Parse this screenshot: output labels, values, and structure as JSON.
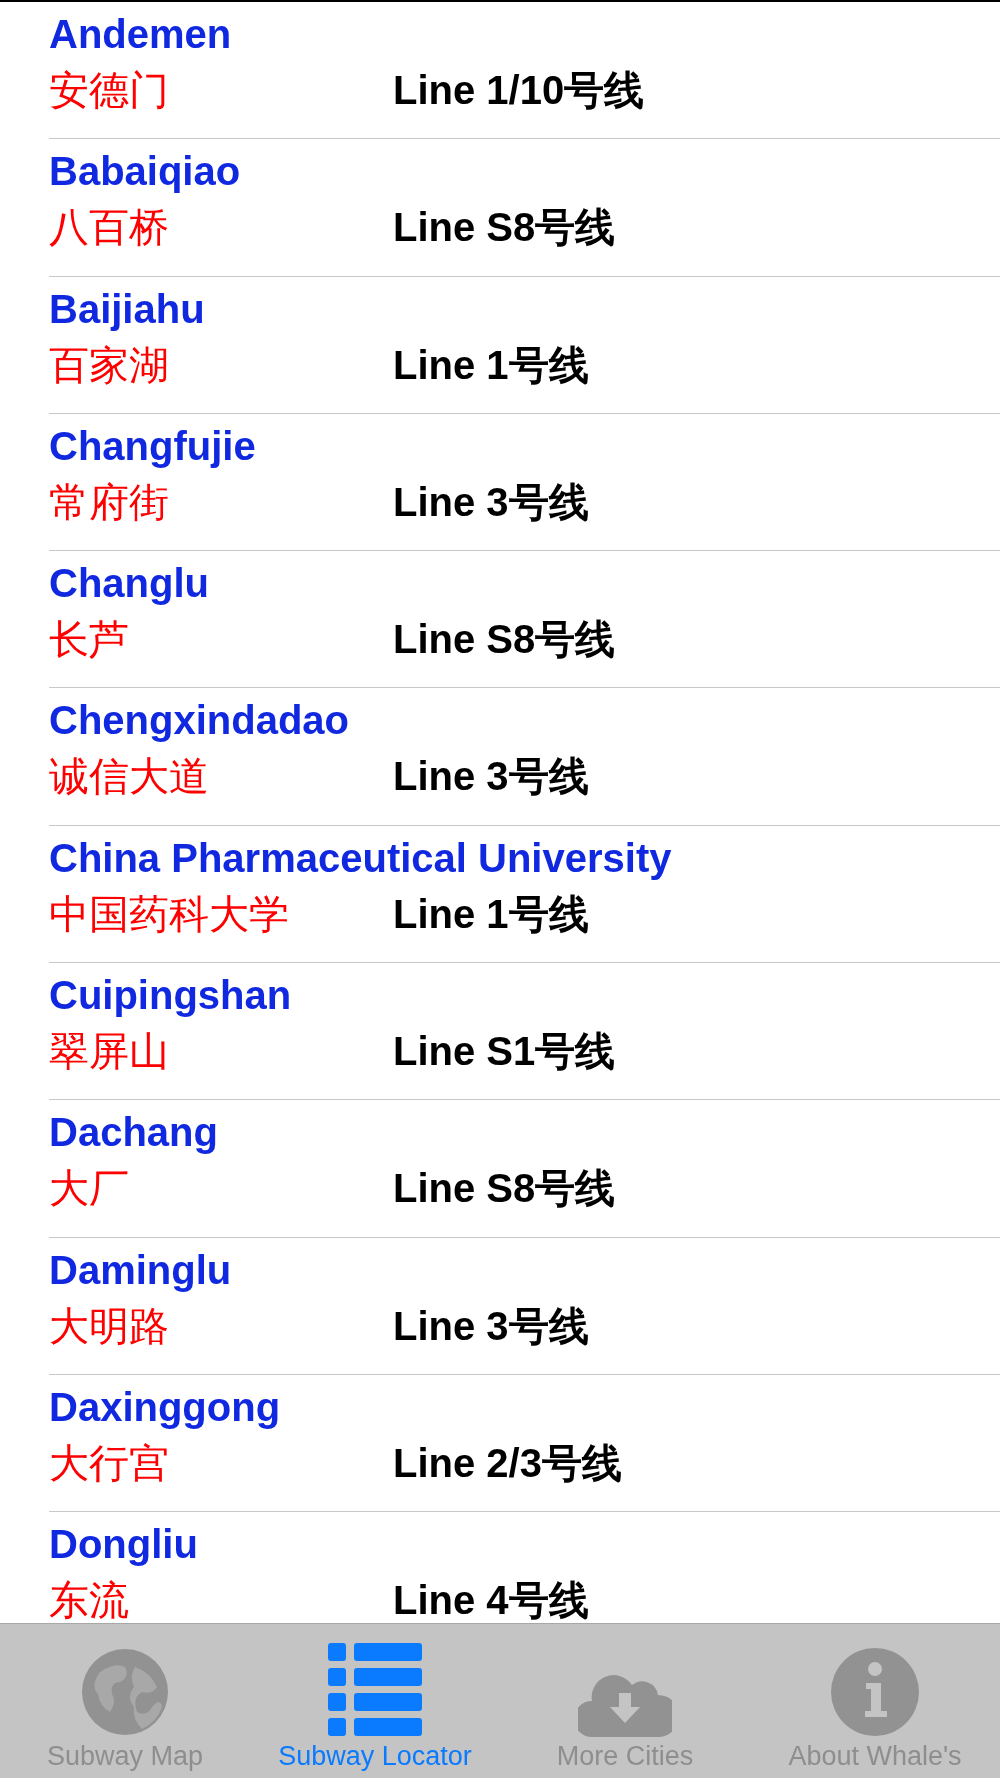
{
  "stations": [
    {
      "name": "Andemen",
      "chinese": "安德门",
      "line": "Line 1/10号线"
    },
    {
      "name": "Babaiqiao",
      "chinese": "八百桥",
      "line": "Line S8号线"
    },
    {
      "name": "Baijiahu",
      "chinese": "百家湖",
      "line": "Line 1号线"
    },
    {
      "name": "Changfujie",
      "chinese": "常府街",
      "line": "Line 3号线"
    },
    {
      "name": "Changlu",
      "chinese": "长芦",
      "line": "Line S8号线"
    },
    {
      "name": "Chengxindadao",
      "chinese": "诚信大道",
      "line": "Line 3号线"
    },
    {
      "name": "China Pharmaceutical University",
      "chinese": "中国药科大学",
      "line": "Line 1号线"
    },
    {
      "name": "Cuipingshan",
      "chinese": "翠屏山",
      "line": "Line S1号线"
    },
    {
      "name": "Dachang",
      "chinese": "大厂",
      "line": "Line S8号线"
    },
    {
      "name": "Daminglu",
      "chinese": "大明路",
      "line": "Line 3号线"
    },
    {
      "name": "Daxinggong",
      "chinese": "大行宫",
      "line": "Line 2/3号线"
    },
    {
      "name": "Dongliu",
      "chinese": "东流",
      "line": "Line 4号线"
    }
  ],
  "tabs": [
    {
      "label": "Subway Map",
      "selected": false
    },
    {
      "label": "Subway Locator",
      "selected": true
    },
    {
      "label": "More Cities",
      "selected": false
    },
    {
      "label": "About Whale's",
      "selected": false
    }
  ]
}
